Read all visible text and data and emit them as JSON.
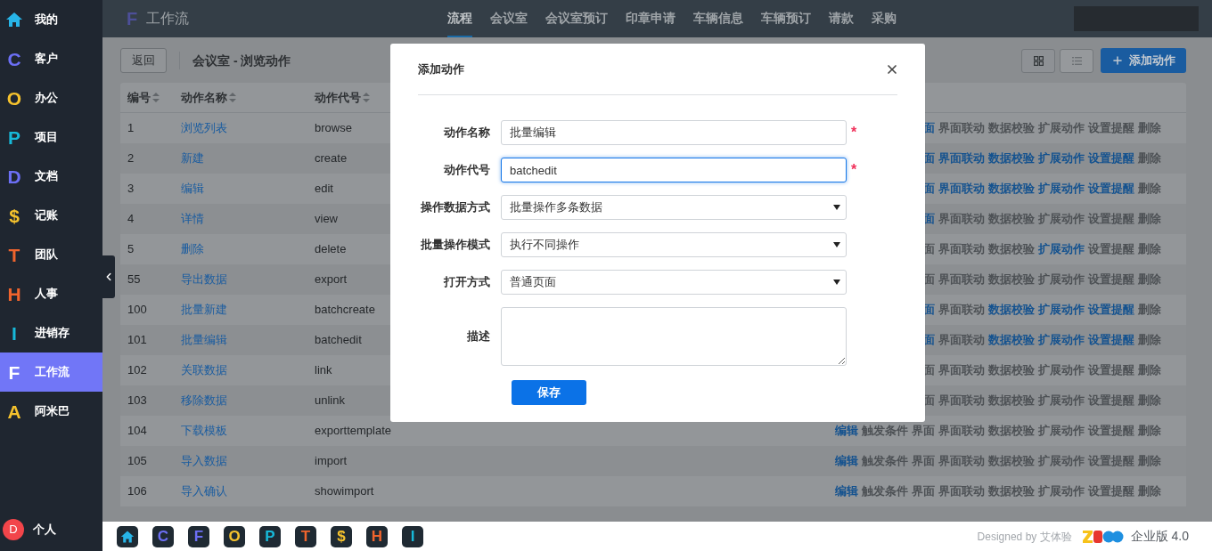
{
  "sidebar": {
    "items": [
      {
        "kind": "home",
        "label": "我的",
        "color": "#27b5e8",
        "selected": false
      },
      {
        "kind": "letter",
        "icon": "C",
        "label": "客户",
        "color": "#6c6ff5",
        "selected": false
      },
      {
        "kind": "letter",
        "icon": "O",
        "label": "办公",
        "color": "#f5c22d",
        "selected": false
      },
      {
        "kind": "letter",
        "icon": "P",
        "label": "项目",
        "color": "#17b9d9",
        "selected": false
      },
      {
        "kind": "letter",
        "icon": "D",
        "label": "文档",
        "color": "#6c6ff5",
        "selected": false
      },
      {
        "kind": "letter",
        "icon": "$",
        "label": "记账",
        "color": "#f5c22d",
        "selected": false
      },
      {
        "kind": "letter",
        "icon": "T",
        "label": "团队",
        "color": "#f0642d",
        "selected": false
      },
      {
        "kind": "letter",
        "icon": "H",
        "label": "人事",
        "color": "#f0642d",
        "selected": false
      },
      {
        "kind": "letter",
        "icon": "I",
        "label": "进销存",
        "color": "#17b9d9",
        "selected": false
      },
      {
        "kind": "letter",
        "icon": "F",
        "label": "工作流",
        "color": "#ffffff",
        "selected": true
      },
      {
        "kind": "letter",
        "icon": "A",
        "label": "阿米巴",
        "color": "#f5c22d",
        "selected": false
      }
    ],
    "user": {
      "avatar": "D",
      "label": "个人"
    }
  },
  "header": {
    "app_icon": "F",
    "app_name": "工作流",
    "tabs": [
      {
        "label": "流程",
        "selected": true
      },
      {
        "label": "会议室",
        "selected": false
      },
      {
        "label": "会议室预订",
        "selected": false
      },
      {
        "label": "印章申请",
        "selected": false
      },
      {
        "label": "车辆信息",
        "selected": false
      },
      {
        "label": "车辆预订",
        "selected": false
      },
      {
        "label": "请款",
        "selected": false
      },
      {
        "label": "采购",
        "selected": false
      }
    ]
  },
  "toolbar": {
    "back": "返回",
    "title": "会议室 - 浏览动作",
    "views": [
      {
        "kind": "grid",
        "selected": true
      },
      {
        "kind": "list",
        "selected": false
      }
    ],
    "add_button": "添加动作"
  },
  "table": {
    "columns": [
      "编号",
      "动作名称",
      "动作代号"
    ],
    "rows": [
      {
        "id": "1",
        "name": "浏览列表",
        "code": "browse",
        "actions": [
          {
            "label": "面",
            "enabled": true
          },
          {
            "label": "界面联动",
            "enabled": false
          },
          {
            "label": "数据校验",
            "enabled": false
          },
          {
            "label": "扩展动作",
            "enabled": false
          },
          {
            "label": "设置提醒",
            "enabled": false
          },
          {
            "label": "删除",
            "enabled": false
          }
        ]
      },
      {
        "id": "2",
        "name": "新建",
        "code": "create",
        "actions": [
          {
            "label": "面",
            "enabled": true
          },
          {
            "label": "界面联动",
            "enabled": true
          },
          {
            "label": "数据校验",
            "enabled": true
          },
          {
            "label": "扩展动作",
            "enabled": true
          },
          {
            "label": "设置提醒",
            "enabled": true
          },
          {
            "label": "删除",
            "enabled": false
          }
        ]
      },
      {
        "id": "3",
        "name": "编辑",
        "code": "edit",
        "actions": [
          {
            "label": "面",
            "enabled": true
          },
          {
            "label": "界面联动",
            "enabled": true
          },
          {
            "label": "数据校验",
            "enabled": true
          },
          {
            "label": "扩展动作",
            "enabled": true
          },
          {
            "label": "设置提醒",
            "enabled": true
          },
          {
            "label": "删除",
            "enabled": false
          }
        ]
      },
      {
        "id": "4",
        "name": "详情",
        "code": "view",
        "actions": [
          {
            "label": "面",
            "enabled": true
          },
          {
            "label": "界面联动",
            "enabled": false
          },
          {
            "label": "数据校验",
            "enabled": false
          },
          {
            "label": "扩展动作",
            "enabled": false
          },
          {
            "label": "设置提醒",
            "enabled": false
          },
          {
            "label": "删除",
            "enabled": false
          }
        ]
      },
      {
        "id": "5",
        "name": "删除",
        "code": "delete",
        "actions": [
          {
            "label": "面",
            "enabled": false
          },
          {
            "label": "界面联动",
            "enabled": false
          },
          {
            "label": "数据校验",
            "enabled": false
          },
          {
            "label": "扩展动作",
            "enabled": true
          },
          {
            "label": "设置提醒",
            "enabled": false
          },
          {
            "label": "删除",
            "enabled": false
          }
        ]
      },
      {
        "id": "55",
        "name": "导出数据",
        "code": "export",
        "actions": [
          {
            "label": "面",
            "enabled": false
          },
          {
            "label": "界面联动",
            "enabled": false
          },
          {
            "label": "数据校验",
            "enabled": false
          },
          {
            "label": "扩展动作",
            "enabled": false
          },
          {
            "label": "设置提醒",
            "enabled": false
          },
          {
            "label": "删除",
            "enabled": false
          }
        ]
      },
      {
        "id": "100",
        "name": "批量新建",
        "code": "batchcreate",
        "actions": [
          {
            "label": "面",
            "enabled": true
          },
          {
            "label": "界面联动",
            "enabled": false
          },
          {
            "label": "数据校验",
            "enabled": true
          },
          {
            "label": "扩展动作",
            "enabled": true
          },
          {
            "label": "设置提醒",
            "enabled": true
          },
          {
            "label": "删除",
            "enabled": false
          }
        ]
      },
      {
        "id": "101",
        "name": "批量编辑",
        "code": "batchedit",
        "actions": [
          {
            "label": "面",
            "enabled": true
          },
          {
            "label": "界面联动",
            "enabled": false
          },
          {
            "label": "数据校验",
            "enabled": true
          },
          {
            "label": "扩展动作",
            "enabled": true
          },
          {
            "label": "设置提醒",
            "enabled": true
          },
          {
            "label": "删除",
            "enabled": false
          }
        ]
      },
      {
        "id": "102",
        "name": "关联数据",
        "code": "link",
        "actions": [
          {
            "label": "面",
            "enabled": false
          },
          {
            "label": "界面联动",
            "enabled": false
          },
          {
            "label": "数据校验",
            "enabled": false
          },
          {
            "label": "扩展动作",
            "enabled": false
          },
          {
            "label": "设置提醒",
            "enabled": false
          },
          {
            "label": "删除",
            "enabled": false
          }
        ]
      },
      {
        "id": "103",
        "name": "移除数据",
        "code": "unlink",
        "actions": [
          {
            "label": "面",
            "enabled": false
          },
          {
            "label": "界面联动",
            "enabled": false
          },
          {
            "label": "数据校验",
            "enabled": false
          },
          {
            "label": "扩展动作",
            "enabled": false
          },
          {
            "label": "设置提醒",
            "enabled": false
          },
          {
            "label": "删除",
            "enabled": false
          }
        ]
      },
      {
        "id": "104",
        "name": "下载模板",
        "code": "exporttemplate",
        "actions": [
          {
            "label": "编辑",
            "enabled": true
          },
          {
            "label": "触发条件",
            "enabled": false
          },
          {
            "label": "界面",
            "enabled": false
          },
          {
            "label": "界面联动",
            "enabled": false
          },
          {
            "label": "数据校验",
            "enabled": false
          },
          {
            "label": "扩展动作",
            "enabled": false
          },
          {
            "label": "设置提醒",
            "enabled": false
          },
          {
            "label": "删除",
            "enabled": false
          }
        ]
      },
      {
        "id": "105",
        "name": "导入数据",
        "code": "import",
        "actions": [
          {
            "label": "编辑",
            "enabled": true
          },
          {
            "label": "触发条件",
            "enabled": false
          },
          {
            "label": "界面",
            "enabled": false
          },
          {
            "label": "界面联动",
            "enabled": false
          },
          {
            "label": "数据校验",
            "enabled": false
          },
          {
            "label": "扩展动作",
            "enabled": false
          },
          {
            "label": "设置提醒",
            "enabled": false
          },
          {
            "label": "删除",
            "enabled": false
          }
        ]
      },
      {
        "id": "106",
        "name": "导入确认",
        "code": "showimport",
        "actions": [
          {
            "label": "编辑",
            "enabled": true
          },
          {
            "label": "触发条件",
            "enabled": false
          },
          {
            "label": "界面",
            "enabled": false
          },
          {
            "label": "界面联动",
            "enabled": false
          },
          {
            "label": "数据校验",
            "enabled": false
          },
          {
            "label": "扩展动作",
            "enabled": false
          },
          {
            "label": "设置提醒",
            "enabled": false
          },
          {
            "label": "删除",
            "enabled": false
          }
        ]
      }
    ]
  },
  "dialog": {
    "title": "添加动作",
    "fields": [
      {
        "label": "动作名称",
        "kind": "text",
        "value": "批量编辑",
        "required": true,
        "focused": false
      },
      {
        "label": "动作代号",
        "kind": "text",
        "value": "batchedit",
        "required": true,
        "focused": true
      },
      {
        "label": "操作数据方式",
        "kind": "select",
        "value": "批量操作多条数据",
        "required": false,
        "focused": false
      },
      {
        "label": "批量操作模式",
        "kind": "select",
        "value": "执行不同操作",
        "required": false,
        "focused": false
      },
      {
        "label": "打开方式",
        "kind": "select",
        "value": "普通页面",
        "required": false,
        "focused": false
      },
      {
        "label": "描述",
        "kind": "textarea",
        "required": false,
        "focused": false
      }
    ],
    "required_mark": "*",
    "save_button": "保存"
  },
  "dock": [
    {
      "kind": "home",
      "color": "#27b5e8"
    },
    {
      "kind": "letter",
      "icon": "C",
      "color": "#6c6ff5"
    },
    {
      "kind": "letter",
      "icon": "F",
      "color": "#6c6ff5"
    },
    {
      "kind": "letter",
      "icon": "O",
      "color": "#f5c22d"
    },
    {
      "kind": "letter",
      "icon": "P",
      "color": "#17b9d9"
    },
    {
      "kind": "letter",
      "icon": "T",
      "color": "#f0642d"
    },
    {
      "kind": "letter",
      "icon": "$",
      "color": "#f5c22d"
    },
    {
      "kind": "letter",
      "icon": "H",
      "color": "#f0642d"
    },
    {
      "kind": "letter",
      "icon": "I",
      "color": "#17b9d9"
    }
  ],
  "footer": {
    "designed_by": "Designed by 艾体验",
    "edition": "企业版 4.0"
  }
}
